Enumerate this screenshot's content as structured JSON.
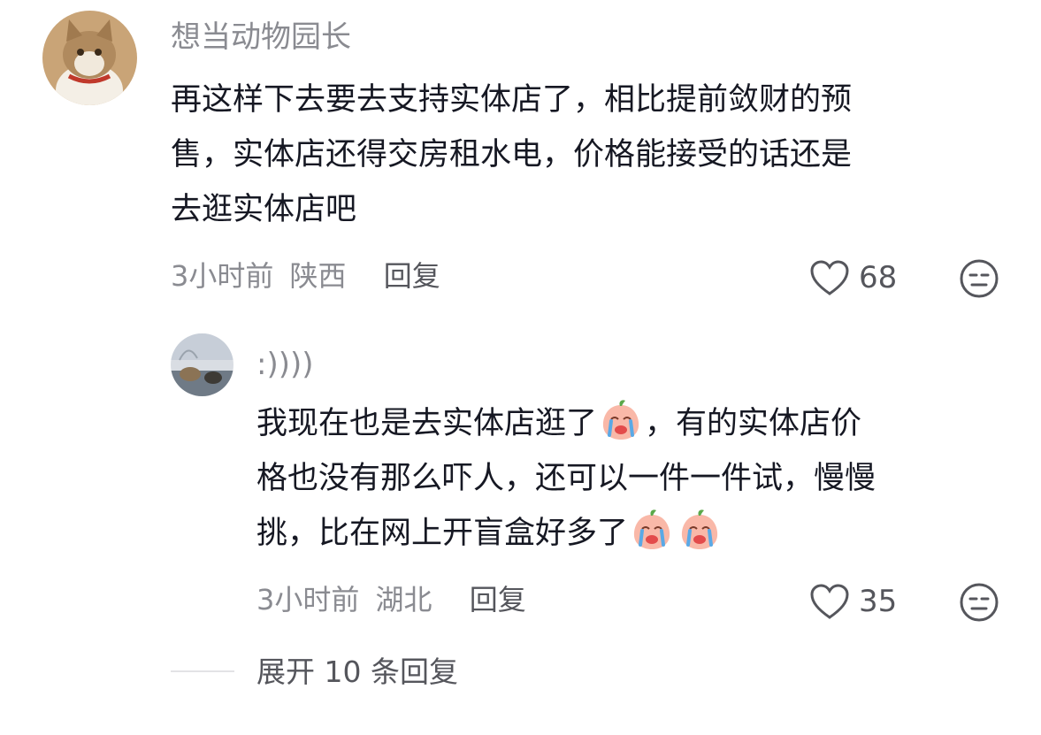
{
  "comment1": {
    "username": "想当动物园长",
    "text_lines": [
      "再这样下去要去支持实体店了，相比提前敛财的预",
      "售，实体店还得交房租水电，价格能接受的话还是",
      "去逛实体店吧"
    ],
    "time": "3小时前",
    "location": "陕西",
    "reply_label": "回复",
    "likes": "68"
  },
  "reply1": {
    "username": ":))))",
    "line1_a": "我现在也是去实体店逛了",
    "line1_b": "，有的实体店价",
    "line2": "格也没有那么吓人，还可以一件一件试，慢慢",
    "line3": "挑，比在网上开盲盒好多了",
    "time": "3小时前",
    "location": "湖北",
    "reply_label": "回复",
    "likes": "35"
  },
  "expand": {
    "label": "展开 10 条回复"
  },
  "icons": {
    "like": "heart-outline-icon",
    "dislike": "neutral-face-icon",
    "emoji": "crying-peach-emoji"
  }
}
